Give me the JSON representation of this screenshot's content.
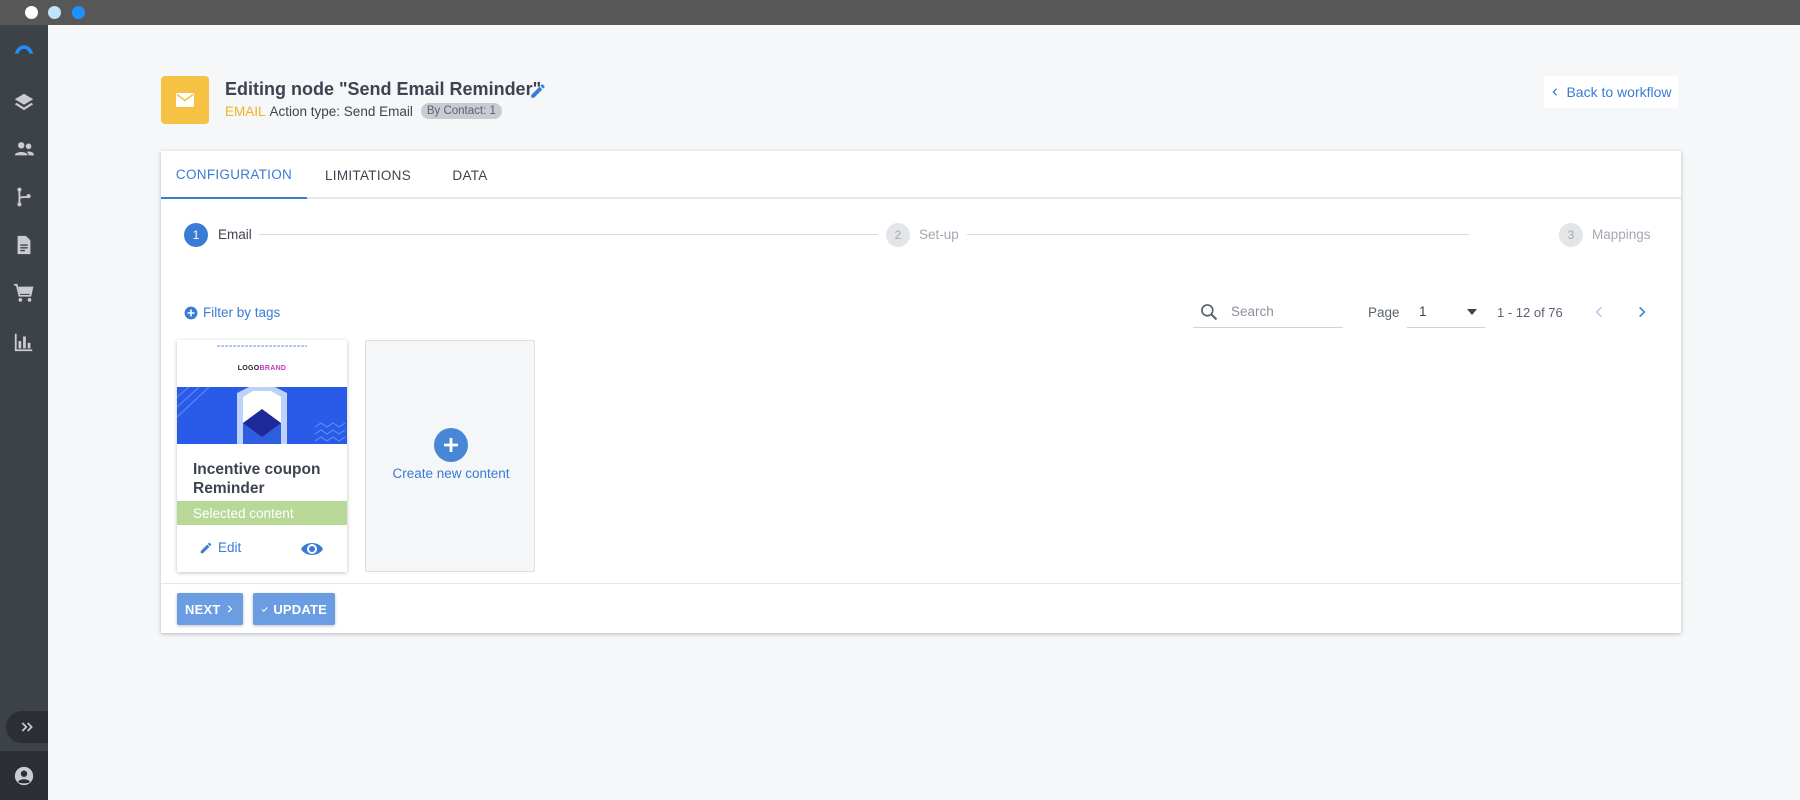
{
  "window": {
    "controls": [
      "close",
      "minimize",
      "maximize"
    ]
  },
  "sidebar": {
    "items": [
      {
        "icon": "brand-logo-icon"
      },
      {
        "icon": "layers-icon"
      },
      {
        "icon": "people-icon"
      },
      {
        "icon": "workflow-branch-icon"
      },
      {
        "icon": "document-icon"
      },
      {
        "icon": "cart-icon"
      },
      {
        "icon": "bar-chart-icon"
      }
    ],
    "expand_icon": "double-chevron-right-icon",
    "user_icon": "account-circle-icon"
  },
  "header": {
    "title": "Editing node \"Send Email Reminder\"",
    "type_tag": "EMAIL",
    "action_type": "Action type: Send Email",
    "badge": "By Contact: 1",
    "back_label": "Back to workflow"
  },
  "tabs": [
    {
      "label": "CONFIGURATION",
      "active": true
    },
    {
      "label": "LIMITATIONS",
      "active": false
    },
    {
      "label": "DATA",
      "active": false
    }
  ],
  "stepper": [
    {
      "number": "1",
      "label": "Email",
      "active": true
    },
    {
      "number": "2",
      "label": "Set-up",
      "active": false
    },
    {
      "number": "3",
      "label": "Mappings",
      "active": false
    }
  ],
  "toolbar": {
    "filter_label": "Filter by tags",
    "search_placeholder": "Search",
    "page_label": "Page",
    "page_value": "1",
    "range_text": "1 - 12 of 76"
  },
  "contents": [
    {
      "title": "Incentive coupon Reminder",
      "selected_label": "Selected content",
      "edit_label": "Edit",
      "thumb_logo": "LOGO",
      "thumb_brand": "BRAND"
    }
  ],
  "create_new_label": "Create new content",
  "footer": {
    "next_label": "NEXT",
    "update_label": "UPDATE"
  },
  "colors": {
    "accent": "#3a7bd5",
    "email_tag": "#f2b321",
    "node_icon_bg": "#f6c244",
    "selected_bg": "#b8d898",
    "sidebar_bg": "#3d4249"
  }
}
